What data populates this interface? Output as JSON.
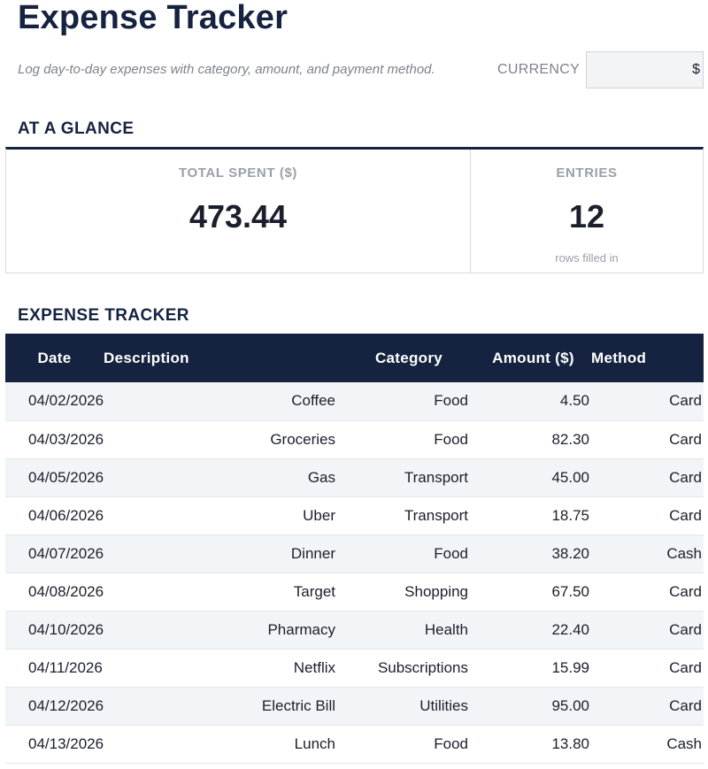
{
  "header": {
    "title": "Expense Tracker",
    "subtitle": "Log day-to-day expenses with category, amount, and payment method.",
    "currency_label": "CURRENCY",
    "currency_value": "$"
  },
  "glance": {
    "section_title": "AT A GLANCE",
    "total_label": "TOTAL SPENT ($)",
    "total_value": "473.44",
    "entries_label": "ENTRIES",
    "entries_value": "12",
    "entries_note": "rows filled in"
  },
  "tracker": {
    "section_title": "EXPENSE TRACKER",
    "columns": [
      "Date",
      "Description",
      "Category",
      "Amount ($)",
      "Method"
    ],
    "rows": [
      {
        "date": "04/02/2026",
        "description": "Coffee",
        "category": "Food",
        "amount": "4.50",
        "method": "Card"
      },
      {
        "date": "04/03/2026",
        "description": "Groceries",
        "category": "Food",
        "amount": "82.30",
        "method": "Card"
      },
      {
        "date": "04/05/2026",
        "description": "Gas",
        "category": "Transport",
        "amount": "45.00",
        "method": "Card"
      },
      {
        "date": "04/06/2026",
        "description": "Uber",
        "category": "Transport",
        "amount": "18.75",
        "method": "Card"
      },
      {
        "date": "04/07/2026",
        "description": "Dinner",
        "category": "Food",
        "amount": "38.20",
        "method": "Cash"
      },
      {
        "date": "04/08/2026",
        "description": "Target",
        "category": "Shopping",
        "amount": "67.50",
        "method": "Card"
      },
      {
        "date": "04/10/2026",
        "description": "Pharmacy",
        "category": "Health",
        "amount": "22.40",
        "method": "Card"
      },
      {
        "date": "04/11/2026",
        "description": "Netflix",
        "category": "Subscriptions",
        "amount": "15.99",
        "method": "Card"
      },
      {
        "date": "04/12/2026",
        "description": "Electric Bill",
        "category": "Utilities",
        "amount": "95.00",
        "method": "Card"
      },
      {
        "date": "04/13/2026",
        "description": "Lunch",
        "category": "Food",
        "amount": "13.80",
        "method": "Cash"
      }
    ]
  },
  "colors": {
    "navy": "#152340",
    "muted_text": "#7d828c",
    "stripe": "#f2f5f7"
  }
}
